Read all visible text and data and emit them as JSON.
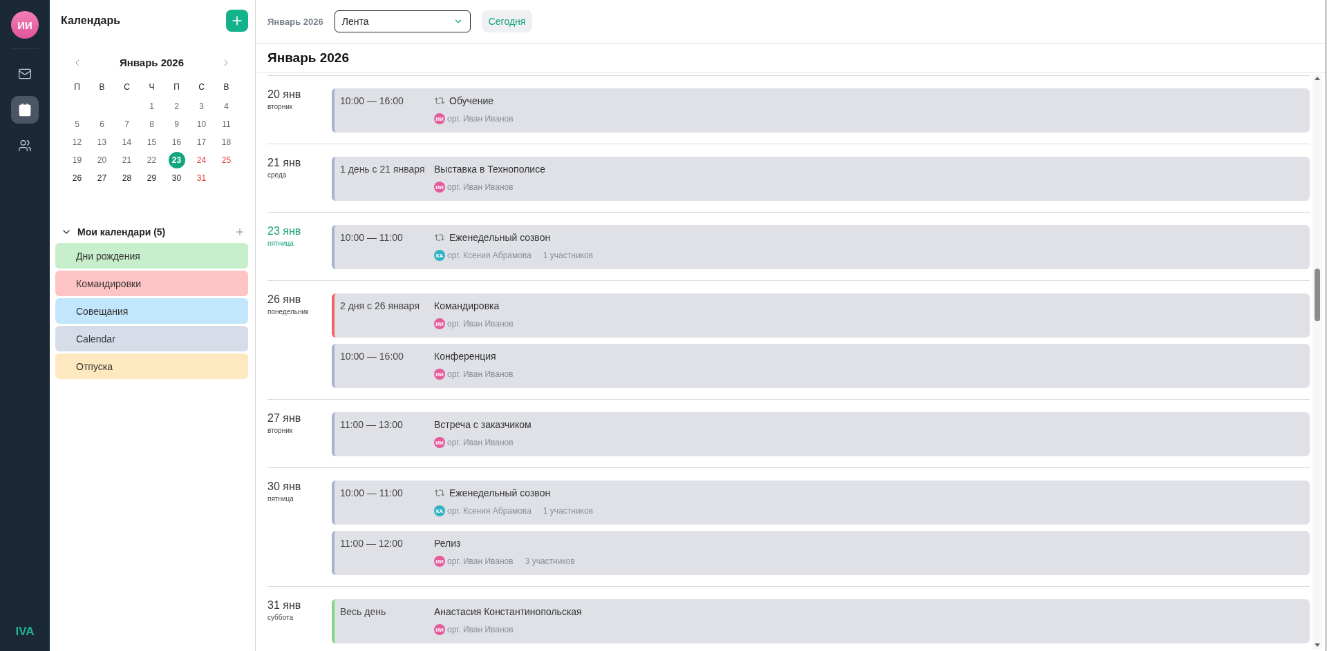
{
  "nav": {
    "avatar": {
      "initials": "ИИ"
    },
    "items": [
      {
        "kind": "mail",
        "selected": false
      },
      {
        "kind": "calendar",
        "selected": true
      },
      {
        "kind": "people",
        "selected": false
      }
    ],
    "logo": "IVA"
  },
  "sidebar": {
    "title": "Календарь",
    "mini_calendar": {
      "title": "Январь 2026",
      "weekdays": [
        "П",
        "В",
        "С",
        "Ч",
        "П",
        "С",
        "В"
      ],
      "weeks": [
        [
          {
            "label": "1",
            "kind": "past"
          },
          {
            "label": "2",
            "kind": "past"
          },
          {
            "label": "3",
            "kind": "past"
          },
          {
            "label": "4",
            "kind": "past"
          }
        ],
        [
          {
            "label": "5",
            "kind": "past"
          },
          {
            "label": "6",
            "kind": "past"
          },
          {
            "label": "7",
            "kind": "past"
          },
          {
            "label": "8",
            "kind": "past"
          },
          {
            "label": "9",
            "kind": "past"
          },
          {
            "label": "10",
            "kind": "past"
          },
          {
            "label": "11",
            "kind": "past"
          }
        ],
        [
          {
            "label": "12",
            "kind": "past"
          },
          {
            "label": "13",
            "kind": "past"
          },
          {
            "label": "14",
            "kind": "past"
          },
          {
            "label": "15",
            "kind": "past"
          },
          {
            "label": "16",
            "kind": "past"
          },
          {
            "label": "17",
            "kind": "past"
          },
          {
            "label": "18",
            "kind": "past"
          }
        ],
        [
          {
            "label": "19",
            "kind": "past"
          },
          {
            "label": "20",
            "kind": "past"
          },
          {
            "label": "21",
            "kind": "past"
          },
          {
            "label": "22",
            "kind": "past"
          },
          {
            "label": "23",
            "kind": "today"
          },
          {
            "label": "24",
            "kind": "weekend"
          },
          {
            "label": "25",
            "kind": "weekend"
          }
        ],
        [
          {
            "label": "26",
            "kind": "future"
          },
          {
            "label": "27",
            "kind": "future"
          },
          {
            "label": "28",
            "kind": "future"
          },
          {
            "label": "29",
            "kind": "future"
          },
          {
            "label": "30",
            "kind": "future"
          },
          {
            "label": "31",
            "kind": "weekend"
          }
        ]
      ]
    },
    "calendars": {
      "title": "Мои календари (5)",
      "expanded": true,
      "items": [
        {
          "name": "Дни рождения",
          "color": "#c8efcb"
        },
        {
          "name": "Командировки",
          "color": "#fec3c3"
        },
        {
          "name": "Совещания",
          "color": "#c2e6fb"
        },
        {
          "name": "Calendar",
          "color": "#d7dde8"
        },
        {
          "name": "Отпуска",
          "color": "#fee8c0"
        }
      ]
    }
  },
  "toolbar": {
    "period": "Январь 2026",
    "view": {
      "value": "Лента"
    },
    "today_button": "Сегодня"
  },
  "feed": {
    "title": "Январь 2026",
    "days": [
      {
        "date": "20 янв",
        "weekday": "вторник",
        "today": false,
        "events": [
          {
            "time": "10:00 — 16:00",
            "title": "Обучение",
            "recurring": true,
            "color": "#a3b4cc",
            "organizer": {
              "initials": "ИИ",
              "color": "#e45c9c",
              "name": "орг. Иван Иванов"
            }
          }
        ]
      },
      {
        "date": "21 янв",
        "weekday": "среда",
        "today": false,
        "events": [
          {
            "time": "1 день с 21 января",
            "title": "Выставка в Технополисе",
            "recurring": false,
            "color": "#a3b4cc",
            "organizer": {
              "initials": "ИИ",
              "color": "#e45c9c",
              "name": "орг. Иван Иванов"
            }
          }
        ]
      },
      {
        "date": "23 янв",
        "weekday": "пятница",
        "today": true,
        "events": [
          {
            "time": "10:00 — 11:00",
            "title": "Еженедельный созвон",
            "recurring": true,
            "color": "#a3b4cc",
            "organizer": {
              "initials": "КА",
              "color": "#32b3c4",
              "name": "орг. Ксения Абрамова"
            },
            "participants": "1 участников"
          }
        ]
      },
      {
        "date": "26 янв",
        "weekday": "понедельник",
        "today": false,
        "events": [
          {
            "time": "2 дня с 26 января",
            "title": "Командировка",
            "recurring": false,
            "color": "#f06464",
            "organizer": {
              "initials": "ИИ",
              "color": "#e45c9c",
              "name": "орг. Иван Иванов"
            }
          },
          {
            "time": "10:00 — 16:00",
            "title": "Конференция",
            "recurring": false,
            "color": "#a3b4cc",
            "organizer": {
              "initials": "ИИ",
              "color": "#e45c9c",
              "name": "орг. Иван Иванов"
            }
          }
        ]
      },
      {
        "date": "27 янв",
        "weekday": "вторник",
        "today": false,
        "events": [
          {
            "time": "11:00 — 13:00",
            "title": "Встреча с заказчиком",
            "recurring": false,
            "color": "#a3b4cc",
            "organizer": {
              "initials": "ИИ",
              "color": "#e45c9c",
              "name": "орг. Иван Иванов"
            }
          }
        ]
      },
      {
        "date": "30 янв",
        "weekday": "пятница",
        "today": false,
        "events": [
          {
            "time": "10:00 — 11:00",
            "title": "Еженедельный созвон",
            "recurring": true,
            "color": "#a3b4cc",
            "organizer": {
              "initials": "КА",
              "color": "#32b3c4",
              "name": "орг. Ксения Абрамова"
            },
            "participants": "1 участников"
          },
          {
            "time": "11:00 — 12:00",
            "title": "Релиз",
            "recurring": false,
            "color": "#a3b4cc",
            "organizer": {
              "initials": "ИИ",
              "color": "#e45c9c",
              "name": "орг. Иван Иванов"
            },
            "participants": "3 участников"
          }
        ]
      },
      {
        "date": "31 янв",
        "weekday": "суббота",
        "today": false,
        "events": [
          {
            "time": "Весь день",
            "title": "Анастасия Константинопольская",
            "recurring": false,
            "color": "#7dd87f",
            "organizer": {
              "initials": "ИИ",
              "color": "#e45c9c",
              "name": "орг. Иван Иванов"
            }
          }
        ]
      }
    ]
  }
}
